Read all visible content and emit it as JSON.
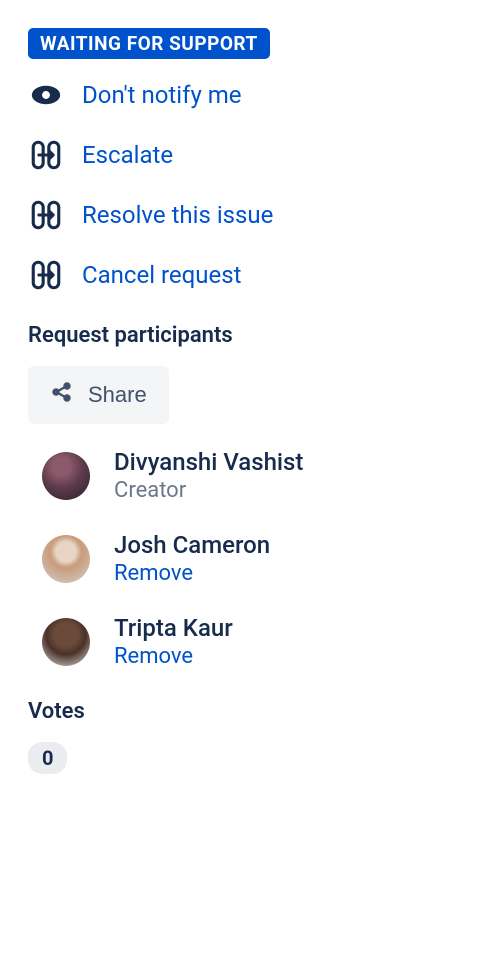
{
  "status": {
    "label": "WAITING FOR SUPPORT"
  },
  "actions": {
    "notify": "Don't notify me",
    "escalate": "Escalate",
    "resolve": "Resolve this issue",
    "cancel": "Cancel request"
  },
  "participants": {
    "title": "Request participants",
    "share_label": "Share",
    "items": [
      {
        "name": "Divyanshi Vashist",
        "role": "Creator",
        "action": null
      },
      {
        "name": "Josh Cameron",
        "role": null,
        "action": "Remove"
      },
      {
        "name": "Tripta Kaur",
        "role": null,
        "action": "Remove"
      }
    ]
  },
  "votes": {
    "title": "Votes",
    "count": "0"
  }
}
